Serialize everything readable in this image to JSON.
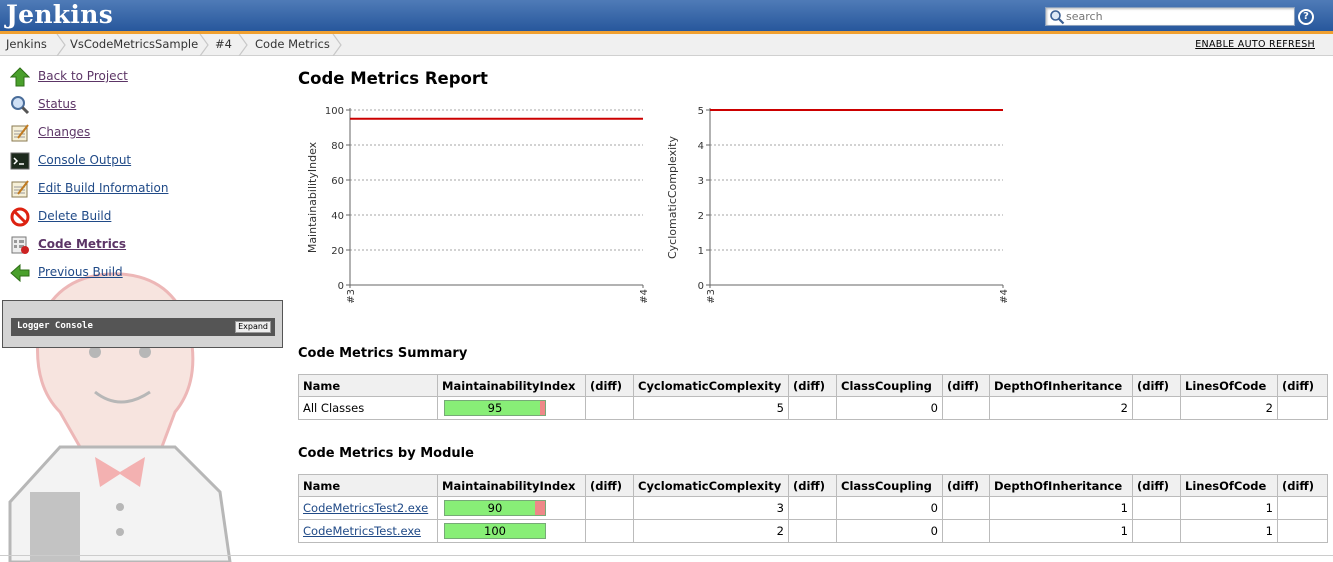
{
  "header": {
    "logo": "Jenkins",
    "search_placeholder": "search",
    "help_label": "?"
  },
  "breadcrumb": {
    "items": [
      "Jenkins",
      "VsCodeMetricsSample",
      "#4",
      "Code Metrics"
    ],
    "auto_refresh": "ENABLE AUTO REFRESH"
  },
  "sidebar": {
    "tasks": [
      {
        "label": "Back to Project",
        "icon": "up-arrow-icon"
      },
      {
        "label": "Status",
        "icon": "magnifier-icon"
      },
      {
        "label": "Changes",
        "icon": "notepad-icon"
      },
      {
        "label": "Console Output",
        "icon": "terminal-icon"
      },
      {
        "label": "Edit Build Information",
        "icon": "notepad-icon"
      },
      {
        "label": "Delete Build",
        "icon": "no-entry-icon"
      },
      {
        "label": "Code Metrics",
        "icon": "report-icon"
      },
      {
        "label": "Previous Build",
        "icon": "left-arrow-icon"
      }
    ],
    "logger": {
      "title": "Logger Console",
      "expand": "Expand"
    }
  },
  "main": {
    "title": "Code Metrics Report",
    "summary_title": "Code Metrics Summary",
    "module_title": "Code Metrics by Module",
    "columns": [
      "Name",
      "MaintainabilityIndex",
      "(diff)",
      "CyclomaticComplexity",
      "(diff)",
      "ClassCoupling",
      "(diff)",
      "DepthOfInheritance",
      "(diff)",
      "LinesOfCode",
      "(diff)"
    ],
    "summary_rows": [
      {
        "name": "All Classes",
        "mi": "95",
        "mi_fraction": 0.95,
        "cc": "5",
        "coupling": "0",
        "depth": "2",
        "loc": "2"
      }
    ],
    "module_rows": [
      {
        "name": "CodeMetricsTest2.exe",
        "mi": "90",
        "mi_fraction": 0.9,
        "cc": "3",
        "coupling": "0",
        "depth": "1",
        "loc": "1"
      },
      {
        "name": "CodeMetricsTest.exe",
        "mi": "100",
        "mi_fraction": 1.0,
        "cc": "2",
        "coupling": "0",
        "depth": "1",
        "loc": "1"
      }
    ]
  },
  "chart_data": [
    {
      "type": "line",
      "ylabel": "MaintainabilityIndex",
      "categories": [
        "#3",
        "#4"
      ],
      "yticks": [
        0,
        20,
        40,
        60,
        80,
        100
      ],
      "ylim": [
        0,
        100
      ],
      "series": [
        {
          "values": [
            95,
            95
          ],
          "color": "#cc0000"
        }
      ],
      "grid": true
    },
    {
      "type": "line",
      "ylabel": "CyclomaticComplexity",
      "categories": [
        "#3",
        "#4"
      ],
      "yticks": [
        0,
        1,
        2,
        3,
        4,
        5
      ],
      "ylim": [
        0,
        5
      ],
      "series": [
        {
          "values": [
            5,
            5
          ],
          "color": "#cc0000"
        }
      ],
      "grid": true
    }
  ]
}
